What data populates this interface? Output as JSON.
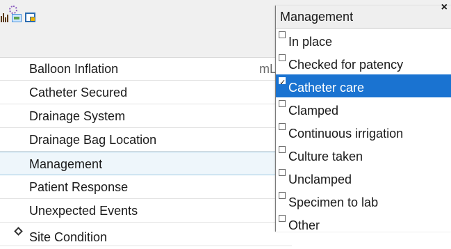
{
  "toolbar": {
    "icons": [
      "bar-chart-icon",
      "gear-icon",
      "spreadsheet-icon",
      "window-icon"
    ]
  },
  "rows": [
    {
      "label": "Balloon Inflation",
      "unit": "mL"
    },
    {
      "label": "Catheter Secured"
    },
    {
      "label": "Drainage System"
    },
    {
      "label": "Drainage Bag Location"
    },
    {
      "label": "Management",
      "selected": true
    },
    {
      "label": "Patient Response"
    },
    {
      "label": "Unexpected Events"
    },
    {
      "label": "Site Condition"
    }
  ],
  "popup": {
    "title": "Management",
    "close_label": "×",
    "options": [
      {
        "label": "In place",
        "checked": false
      },
      {
        "label": "Checked for patency",
        "checked": false
      },
      {
        "label": "Catheter care",
        "checked": true
      },
      {
        "label": "Clamped",
        "checked": false
      },
      {
        "label": "Continuous irrigation",
        "checked": false
      },
      {
        "label": "Culture taken",
        "checked": false
      },
      {
        "label": "Unclamped",
        "checked": false
      },
      {
        "label": "Specimen to lab",
        "checked": false
      },
      {
        "label": "Other",
        "checked": false
      }
    ]
  },
  "colors": {
    "selection": "#1a73d1",
    "row_selected_bg": "#eef6fb"
  }
}
